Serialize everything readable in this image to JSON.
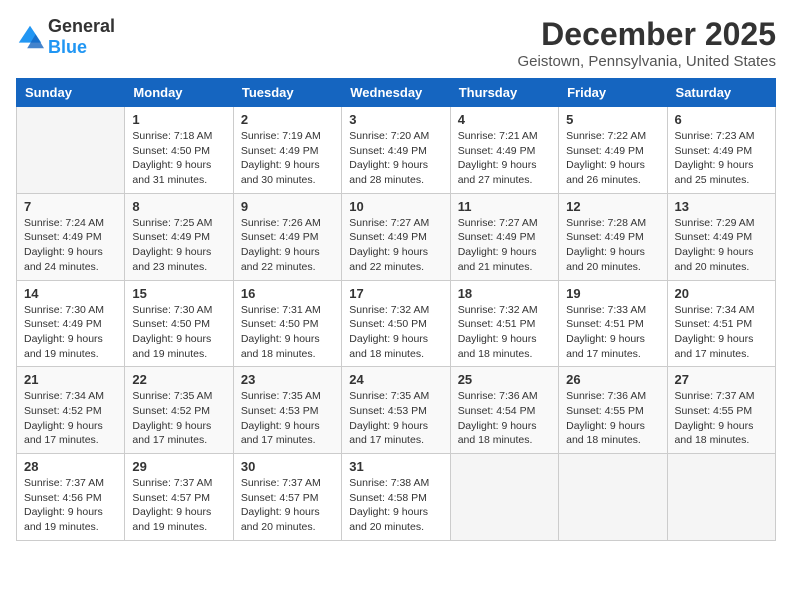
{
  "logo": {
    "general": "General",
    "blue": "Blue"
  },
  "header": {
    "month": "December 2025",
    "location": "Geistown, Pennsylvania, United States"
  },
  "weekdays": [
    "Sunday",
    "Monday",
    "Tuesday",
    "Wednesday",
    "Thursday",
    "Friday",
    "Saturday"
  ],
  "weeks": [
    [
      {
        "day": "",
        "info": ""
      },
      {
        "day": "1",
        "info": "Sunrise: 7:18 AM\nSunset: 4:50 PM\nDaylight: 9 hours\nand 31 minutes."
      },
      {
        "day": "2",
        "info": "Sunrise: 7:19 AM\nSunset: 4:49 PM\nDaylight: 9 hours\nand 30 minutes."
      },
      {
        "day": "3",
        "info": "Sunrise: 7:20 AM\nSunset: 4:49 PM\nDaylight: 9 hours\nand 28 minutes."
      },
      {
        "day": "4",
        "info": "Sunrise: 7:21 AM\nSunset: 4:49 PM\nDaylight: 9 hours\nand 27 minutes."
      },
      {
        "day": "5",
        "info": "Sunrise: 7:22 AM\nSunset: 4:49 PM\nDaylight: 9 hours\nand 26 minutes."
      },
      {
        "day": "6",
        "info": "Sunrise: 7:23 AM\nSunset: 4:49 PM\nDaylight: 9 hours\nand 25 minutes."
      }
    ],
    [
      {
        "day": "7",
        "info": "Sunrise: 7:24 AM\nSunset: 4:49 PM\nDaylight: 9 hours\nand 24 minutes."
      },
      {
        "day": "8",
        "info": "Sunrise: 7:25 AM\nSunset: 4:49 PM\nDaylight: 9 hours\nand 23 minutes."
      },
      {
        "day": "9",
        "info": "Sunrise: 7:26 AM\nSunset: 4:49 PM\nDaylight: 9 hours\nand 22 minutes."
      },
      {
        "day": "10",
        "info": "Sunrise: 7:27 AM\nSunset: 4:49 PM\nDaylight: 9 hours\nand 22 minutes."
      },
      {
        "day": "11",
        "info": "Sunrise: 7:27 AM\nSunset: 4:49 PM\nDaylight: 9 hours\nand 21 minutes."
      },
      {
        "day": "12",
        "info": "Sunrise: 7:28 AM\nSunset: 4:49 PM\nDaylight: 9 hours\nand 20 minutes."
      },
      {
        "day": "13",
        "info": "Sunrise: 7:29 AM\nSunset: 4:49 PM\nDaylight: 9 hours\nand 20 minutes."
      }
    ],
    [
      {
        "day": "14",
        "info": "Sunrise: 7:30 AM\nSunset: 4:49 PM\nDaylight: 9 hours\nand 19 minutes."
      },
      {
        "day": "15",
        "info": "Sunrise: 7:30 AM\nSunset: 4:50 PM\nDaylight: 9 hours\nand 19 minutes."
      },
      {
        "day": "16",
        "info": "Sunrise: 7:31 AM\nSunset: 4:50 PM\nDaylight: 9 hours\nand 18 minutes."
      },
      {
        "day": "17",
        "info": "Sunrise: 7:32 AM\nSunset: 4:50 PM\nDaylight: 9 hours\nand 18 minutes."
      },
      {
        "day": "18",
        "info": "Sunrise: 7:32 AM\nSunset: 4:51 PM\nDaylight: 9 hours\nand 18 minutes."
      },
      {
        "day": "19",
        "info": "Sunrise: 7:33 AM\nSunset: 4:51 PM\nDaylight: 9 hours\nand 17 minutes."
      },
      {
        "day": "20",
        "info": "Sunrise: 7:34 AM\nSunset: 4:51 PM\nDaylight: 9 hours\nand 17 minutes."
      }
    ],
    [
      {
        "day": "21",
        "info": "Sunrise: 7:34 AM\nSunset: 4:52 PM\nDaylight: 9 hours\nand 17 minutes."
      },
      {
        "day": "22",
        "info": "Sunrise: 7:35 AM\nSunset: 4:52 PM\nDaylight: 9 hours\nand 17 minutes."
      },
      {
        "day": "23",
        "info": "Sunrise: 7:35 AM\nSunset: 4:53 PM\nDaylight: 9 hours\nand 17 minutes."
      },
      {
        "day": "24",
        "info": "Sunrise: 7:35 AM\nSunset: 4:53 PM\nDaylight: 9 hours\nand 17 minutes."
      },
      {
        "day": "25",
        "info": "Sunrise: 7:36 AM\nSunset: 4:54 PM\nDaylight: 9 hours\nand 18 minutes."
      },
      {
        "day": "26",
        "info": "Sunrise: 7:36 AM\nSunset: 4:55 PM\nDaylight: 9 hours\nand 18 minutes."
      },
      {
        "day": "27",
        "info": "Sunrise: 7:37 AM\nSunset: 4:55 PM\nDaylight: 9 hours\nand 18 minutes."
      }
    ],
    [
      {
        "day": "28",
        "info": "Sunrise: 7:37 AM\nSunset: 4:56 PM\nDaylight: 9 hours\nand 19 minutes."
      },
      {
        "day": "29",
        "info": "Sunrise: 7:37 AM\nSunset: 4:57 PM\nDaylight: 9 hours\nand 19 minutes."
      },
      {
        "day": "30",
        "info": "Sunrise: 7:37 AM\nSunset: 4:57 PM\nDaylight: 9 hours\nand 20 minutes."
      },
      {
        "day": "31",
        "info": "Sunrise: 7:38 AM\nSunset: 4:58 PM\nDaylight: 9 hours\nand 20 minutes."
      },
      {
        "day": "",
        "info": ""
      },
      {
        "day": "",
        "info": ""
      },
      {
        "day": "",
        "info": ""
      }
    ]
  ]
}
